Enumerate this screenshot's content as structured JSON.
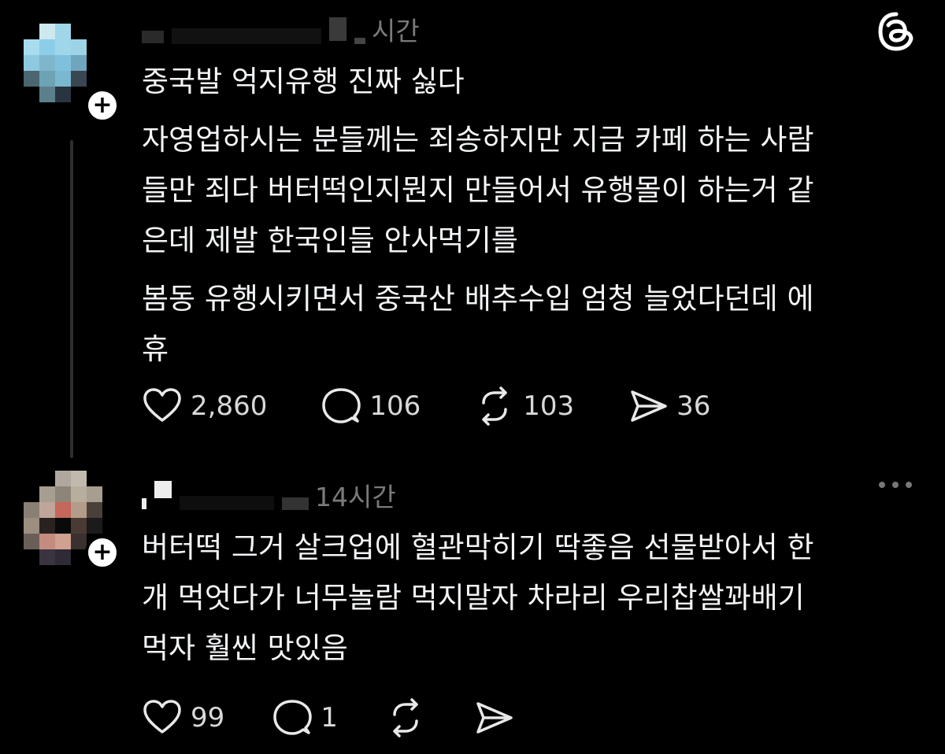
{
  "app": {
    "logo_icon": "threads-logo-icon"
  },
  "colors": {
    "background": "#000000",
    "text": "#f3f5f7",
    "muted": "#7a7a7a",
    "thread_line": "#2e2e2e"
  },
  "posts": [
    {
      "time": "시간",
      "paragraphs": [
        [
          "중국발 억지유행 진짜 싫다"
        ],
        [
          "자영업하시는 분들께는 죄송하지만 지금 카페 하는 사람",
          "들만 죄다 버터떡인지뭔지 만들어서 유행몰이 하는거 같",
          "은데 제발 한국인들 안사먹기를"
        ],
        [
          "봄동 유행시키면서 중국산 배추수입 엄청 늘었다던데 에",
          "휴"
        ]
      ],
      "actions": {
        "likes": "2,860",
        "replies": "106",
        "reposts": "103",
        "shares": "36"
      }
    },
    {
      "time": "14시간",
      "paragraphs": [
        [
          "버터떡 그거 살크업에 혈관막히기 딱좋음 선물받아서 한",
          "개 먹엇다가 너무놀람 먹지말자 차라리 우리찹쌀꽈배기",
          "먹자 훨씬 맛있음"
        ]
      ],
      "actions": {
        "likes": "99",
        "replies": "1",
        "reposts": "",
        "shares": ""
      }
    }
  ]
}
